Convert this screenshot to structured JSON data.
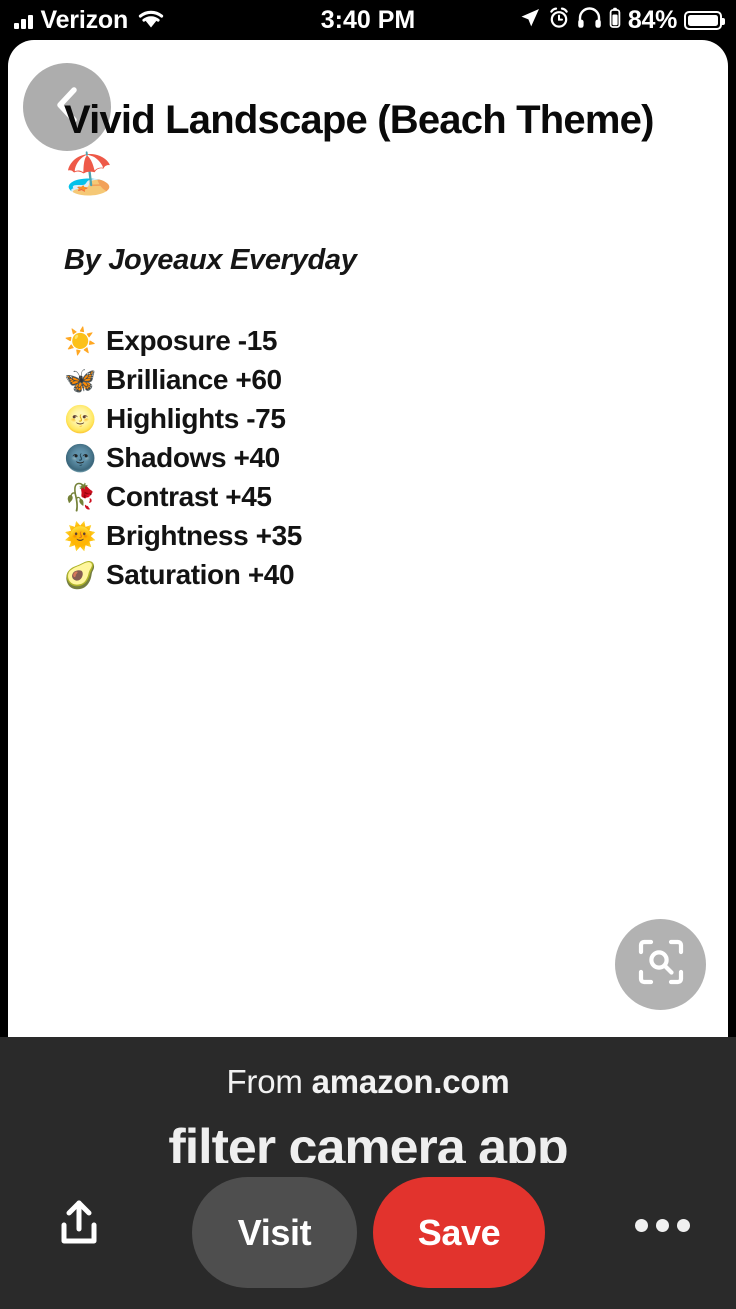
{
  "statusbar": {
    "carrier": "Verizon",
    "time": "3:40 PM",
    "battery_percent": "84%",
    "icons": {
      "signal": "cellular-signal-icon",
      "wifi": "wifi-icon",
      "location": "location-arrow-icon",
      "alarm": "alarm-clock-icon",
      "headphones": "headphones-icon",
      "headphone_battery": "headphone-battery-icon",
      "battery": "battery-icon"
    }
  },
  "pin": {
    "back_icon": "chevron-left-icon",
    "title": "Vivid Landscape (Beach Theme) 🏖️",
    "author": "By Joyeaux Everyday",
    "settings": [
      {
        "emoji": "☀️",
        "label": "Exposure -15"
      },
      {
        "emoji": "🦋",
        "label": "Brilliance +60"
      },
      {
        "emoji": "🌝",
        "label": "Highlights -75"
      },
      {
        "emoji": "🌚",
        "label": "Shadows +40"
      },
      {
        "emoji": "🥀",
        "label": "Contrast +45"
      },
      {
        "emoji": "🌞",
        "label": "Brightness +35"
      },
      {
        "emoji": "🥑",
        "label": "Saturation +40"
      }
    ],
    "lens_icon": "visual-search-icon"
  },
  "source": {
    "from_prefix": "From ",
    "domain": "amazon.com",
    "description": "filter camera app"
  },
  "actions": {
    "share_icon": "share-icon",
    "visit_label": "Visit",
    "save_label": "Save",
    "more_icon": "more-horizontal-icon"
  },
  "colors": {
    "save_red": "#e2332d",
    "visit_gray": "#4e4e4e",
    "bottom_bar": "#2a2a2a",
    "back_button_gray": "#adadad"
  }
}
